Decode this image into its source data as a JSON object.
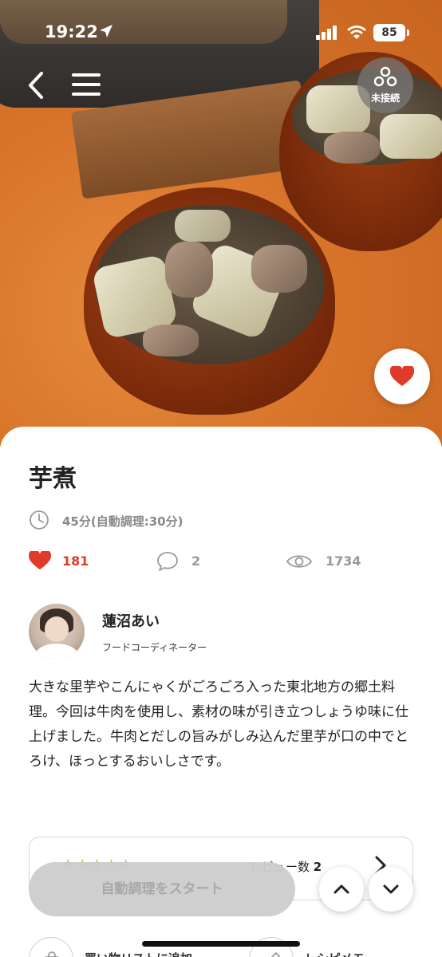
{
  "status_bar": {
    "time": "19:22",
    "battery": "85"
  },
  "header": {
    "device_status": "未接続"
  },
  "recipe": {
    "title": "芋煮",
    "cook_time": "45分(自動調理:30分)",
    "likes": "181",
    "comments": "2",
    "views": "1734",
    "description": "大きな里芋やこんにゃくがごろごろ入った東北地方の郷土料理。今回は牛肉を使用し、素材の味が引き立つしょうゆ味に仕上げました。牛肉とだしの旨みがしみ込んだ里芋が口の中でとろけ、ほっとするおいしさです。"
  },
  "author": {
    "name": "蓮沼あい",
    "role": "フードコーディネーター"
  },
  "review": {
    "stars": "★★★★★",
    "count_label": "レビュー数",
    "count": "2"
  },
  "actions": {
    "start_label": "自動調理をスタート",
    "shopping_list_label": "買い物リストに追加",
    "memo_label": "レシピメモ"
  },
  "colors": {
    "accent": "#e03a2a",
    "star": "#f2b705",
    "muted": "#999999"
  }
}
